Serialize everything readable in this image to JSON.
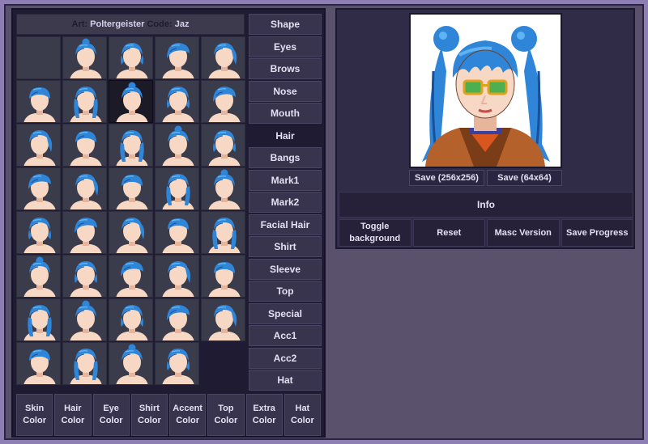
{
  "credit": {
    "art_label": "Art:",
    "art_value": "Poltergeister",
    "code_label": "Code:",
    "code_value": "Jaz"
  },
  "hair_grid": {
    "selected_index": 7,
    "styles": [
      "blank",
      "long-bangs",
      "long-straight",
      "side-swept",
      "short-side",
      "top-bun",
      "twin-buns",
      "twintails-long",
      "ponytail",
      "flowing",
      "spiky-short",
      "cropped",
      "crew",
      "flat-top",
      "side-part",
      "side-fringe",
      "bob",
      "fluffy",
      "swept",
      "short-back",
      "mohawk",
      "shag",
      "curly",
      "long-layers",
      "twin-puffs",
      "curly-top",
      "low-pigtails",
      "messy",
      "wavy-long",
      "wavy-short",
      "mini-buns",
      "undercut",
      "pixie",
      "buzz",
      "space-buns",
      "curly-long",
      "wavy-bob",
      "chin-bob",
      "tousled"
    ]
  },
  "categories": [
    "Shape",
    "Eyes",
    "Brows",
    "Nose",
    "Mouth",
    "Hair",
    "Bangs",
    "Mark1",
    "Mark2",
    "Facial Hair",
    "Shirt",
    "Sleeve",
    "Top",
    "Special",
    "Acc1",
    "Acc2",
    "Hat"
  ],
  "active_category": "Hair",
  "color_buttons": [
    {
      "line1": "Skin",
      "line2": "Color"
    },
    {
      "line1": "Hair",
      "line2": "Color"
    },
    {
      "line1": "Eye",
      "line2": "Color"
    },
    {
      "line1": "Shirt",
      "line2": "Color"
    },
    {
      "line1": "Accent",
      "line2": "Color"
    },
    {
      "line1": "Top",
      "line2": "Color"
    },
    {
      "line1": "Extra",
      "line2": "Color"
    },
    {
      "line1": "Hat",
      "line2": "Color"
    }
  ],
  "save_buttons": {
    "large": "Save (256x256)",
    "small": "Save (64x64)"
  },
  "info_label": "Info",
  "actions": {
    "toggle_line1": "Toggle",
    "toggle_line2": "background",
    "reset": "Reset",
    "masc": "Masc Version",
    "save_progress": "Save Progress"
  },
  "colors": {
    "hair": "#2f86d8",
    "hair_light": "#5fb3f0",
    "hair_dark": "#1a4f9a",
    "skin": "#f7d8c4",
    "skin_shade": "#e7b49c",
    "glasses": "#e0a020",
    "lens": "#4caf50",
    "jacket": "#b5612b",
    "jacket_dark": "#7a3d18",
    "shirt_inner": "#d9571f"
  }
}
